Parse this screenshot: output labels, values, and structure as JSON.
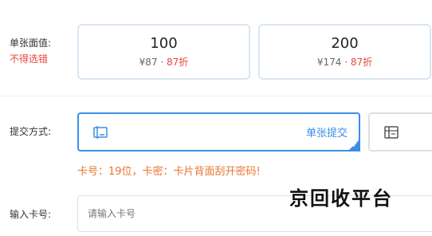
{
  "denomination": {
    "label": "单张面值:",
    "warning": "不得选错",
    "options": [
      {
        "amount": "100",
        "price": "¥87",
        "sep": " · ",
        "discount": "87折"
      },
      {
        "amount": "200",
        "price": "¥174",
        "sep": " · ",
        "discount": "87折"
      }
    ]
  },
  "submit": {
    "label": "提交方式:",
    "methods": [
      {
        "label": "单张提交",
        "selected": true,
        "icon": "card-icon"
      },
      {
        "label": "",
        "selected": false,
        "icon": "batch-card-icon"
      }
    ]
  },
  "hint": "卡号：19位，卡密：卡片背面刮开密码!",
  "card_number": {
    "label": "输入卡号:",
    "placeholder": "请输入卡号"
  },
  "watermark": "京回收平台",
  "colors": {
    "accent": "#3a8ee6",
    "warning": "#e8463a",
    "hint": "#e8752f"
  }
}
